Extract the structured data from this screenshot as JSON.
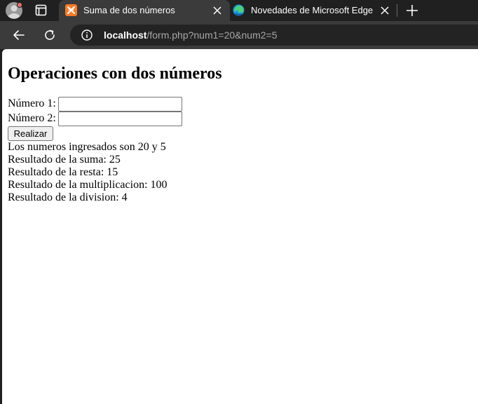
{
  "browser": {
    "tabs": [
      {
        "title": "Suma de dos números",
        "active": true,
        "favicon": "xampp-icon"
      },
      {
        "title": "Novedades de Microsoft Edge",
        "active": false,
        "favicon": "edge-icon"
      }
    ],
    "address": {
      "host": "localhost",
      "path": "/form.php?num1=20&num2=5"
    },
    "colors": {
      "tabstrip_bg": "#202020",
      "toolbar_bg": "#3b3b3b",
      "xampp_orange": "#fb7a24"
    }
  },
  "page": {
    "title": "Operaciones con dos números",
    "form": {
      "num1_label": "Número 1:",
      "num1_value": "",
      "num2_label": "Número 2:",
      "num2_value": "",
      "submit_label": "Realizar"
    },
    "results": [
      "Los numeros ingresados son 20 y 5",
      "Resultado de la suma: 25",
      "Resultado de la resta: 15",
      "Resultado de la multiplicacion: 100",
      "Resultado de la division: 4"
    ]
  }
}
